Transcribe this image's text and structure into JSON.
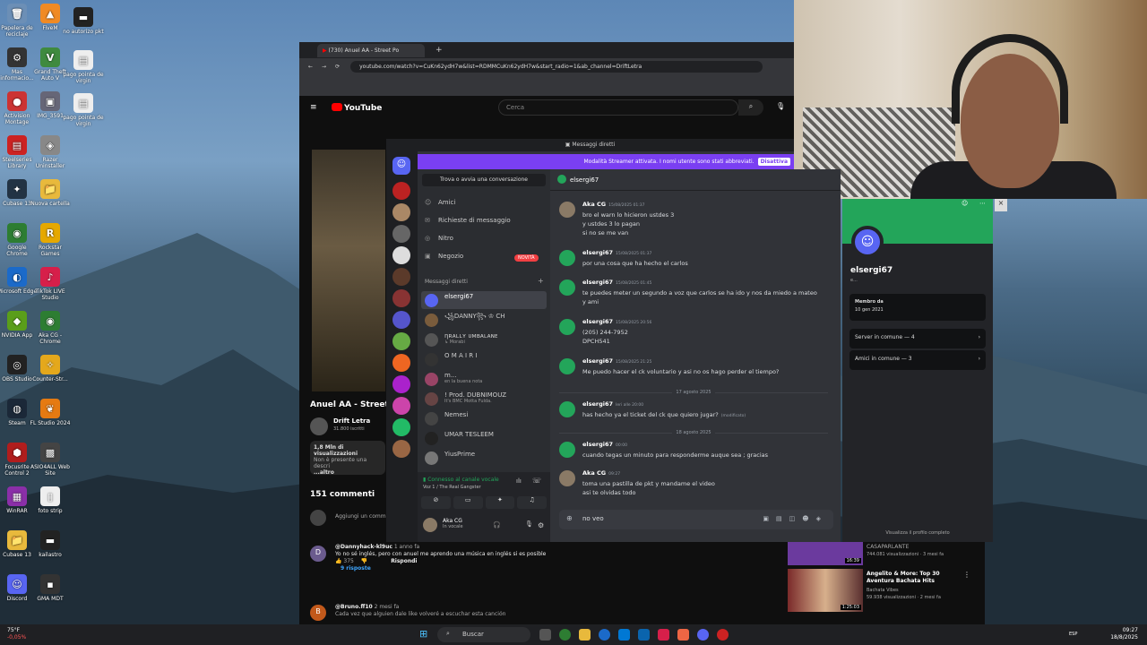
{
  "desktop": {
    "icons": [
      {
        "label": "Papelera de reciclaje",
        "glyph": "🗑",
        "color": "#6c8fb6"
      },
      {
        "label": "Mas informacio...",
        "glyph": "⚙",
        "color": "#333"
      },
      {
        "label": "Activision Montage",
        "glyph": "●",
        "color": "#c33"
      },
      {
        "label": "Steelseries Library",
        "glyph": "▤",
        "color": "#c22"
      },
      {
        "label": "Cubase 13",
        "glyph": "✦",
        "color": "#234"
      },
      {
        "label": "Google Chrome",
        "glyph": "◉",
        "color": "#2d7d32"
      },
      {
        "label": "Microsoft Edge",
        "glyph": "◐",
        "color": "#1b6ac9"
      },
      {
        "label": "NVIDIA App",
        "glyph": "◆",
        "color": "#5a9e1a"
      },
      {
        "label": "OBS Studio",
        "glyph": "◎",
        "color": "#222"
      },
      {
        "label": "Steam",
        "glyph": "◍",
        "color": "#1b2838"
      },
      {
        "label": "Focusrite Control 2",
        "glyph": "⬢",
        "color": "#b01d1d"
      },
      {
        "label": "WinRAR",
        "glyph": "▦",
        "color": "#8b2fa8"
      },
      {
        "label": "Cubase 13",
        "glyph": "📁",
        "color": "#e8b93c"
      },
      {
        "label": "Discord",
        "glyph": "☺",
        "color": "#5865f2"
      }
    ],
    "icons2": [
      {
        "label": "FiveM",
        "glyph": "▲",
        "color": "#f08a24"
      },
      {
        "label": "Grand Theft Auto V",
        "glyph": "V",
        "color": "#3f8a3f"
      },
      {
        "label": "IMG_3591",
        "glyph": "▣",
        "color": "#667"
      },
      {
        "label": "Razer Uninstaller",
        "glyph": "◈",
        "color": "#888"
      },
      {
        "label": "Nuova cartella",
        "glyph": "📁",
        "color": "#e8b93c"
      },
      {
        "label": "Rockstar Games",
        "glyph": "R",
        "color": "#e5a800"
      },
      {
        "label": "TikTok LIVE Studio",
        "glyph": "♪",
        "color": "#d61f4a"
      },
      {
        "label": "Aka CG - Chrome",
        "glyph": "◉",
        "color": "#2d7d32"
      },
      {
        "label": "Counter-Str...",
        "glyph": "✧",
        "color": "#e4a81c"
      },
      {
        "label": "FL Studio 2024",
        "glyph": "❦",
        "color": "#e57a12"
      },
      {
        "label": "ASIO4ALL Web Site",
        "glyph": "▩",
        "color": "#444"
      },
      {
        "label": "foto strip",
        "glyph": "▯",
        "color": "#eee"
      },
      {
        "label": "kailastro",
        "glyph": "▬",
        "color": "#222"
      },
      {
        "label": "GMA MDT",
        "glyph": "▪",
        "color": "#333"
      }
    ],
    "icons3": [
      {
        "label": "no autorizo pkt",
        "glyph": "▬",
        "color": "#222"
      },
      {
        "label": "pago pointa de virgin",
        "glyph": "▤",
        "color": "#eee"
      },
      {
        "label": "pago pointa de virgin",
        "glyph": "▤",
        "color": "#eee"
      }
    ]
  },
  "taskbar": {
    "weather_temp": "75°F",
    "weather_text": "-0,05%",
    "search_placeholder": "Buscar",
    "lang": "ESP",
    "time": "09:27",
    "date": "18/8/2025"
  },
  "browser": {
    "tab_title": "(730) Anuel AA - Street Po",
    "url": "youtube.com/watch?v=CuKn62ydH7w&list=RDMMCuKn62ydH7w&start_radio=1&ab_channel=DriftLetra",
    "youtube": {
      "logo": "YouTube",
      "search_placeholder": "Cerca",
      "video_title": "Anuel AA - Street P",
      "channel": "Drift Letra",
      "subscribers": "31.800 iscritti",
      "views": "1,8 Mln di visualizzazioni",
      "desc_line": "Non è presente una descri",
      "desc_more": "...altro",
      "comments_count": "151 commenti",
      "add_comment": "Aggiungi un comm",
      "comments": [
        {
          "avatar": "D",
          "user": "@Dannyhack-kl9uc",
          "age": "1 anno fa",
          "text": "Yo no sé inglés, pero con anuel me aprendo una música en inglés si es posible",
          "likes": "375",
          "reply": "Rispondi",
          "replies": "9 risposte"
        },
        {
          "avatar": "B",
          "user": "@Bruno.ff10",
          "age": "2 mesi fa",
          "text": "Cada vez que alguien dale like volveré a escuchar esta canción"
        }
      ],
      "sidebar": [
        {
          "title": "CASAPARLANTE",
          "meta": "744.081 visualizzazioni · 3 mesi fa",
          "duration": "16:39"
        },
        {
          "title": "Angelito & More: Top 30 Aventura Bachata Hits",
          "channel": "Bachata Vibes",
          "meta": "59.938 visualizzazioni · 2 mesi fa",
          "duration": "1:25:03"
        }
      ]
    }
  },
  "discord": {
    "window_title": "Messaggi diretti",
    "streamer_banner": "Modalità Streamer attivata. I nomi utente sono stati abbreviati.",
    "streamer_button": "Disattiva",
    "find_conversation": "Trova o avvia una conversazione",
    "nav": [
      {
        "icon": "☺",
        "label": "Amici"
      },
      {
        "icon": "✉",
        "label": "Richieste di messaggio"
      },
      {
        "icon": "◎",
        "label": "Nitro"
      },
      {
        "icon": "▣",
        "label": "Negozio",
        "badge": "NOVITÀ"
      }
    ],
    "dm_header": "Messaggi diretti",
    "dm_list": [
      {
        "name": "elsergi67",
        "sub": "",
        "color": "#5865f2",
        "active": true
      },
      {
        "name": "꧁DANNY꧂ ♔ CH",
        "sub": "",
        "color": "#7a5c3c"
      },
      {
        "name": "ηʀᴀʟʟʏ ᴜᴍʙᴀʟᴀɴᴇ",
        "sub": "↳ Morabi",
        "color": "#555"
      },
      {
        "name": "O M A I R I",
        "sub": "",
        "color": "#333"
      },
      {
        "name": "m...",
        "sub": "en la buena nota",
        "color": "#946"
      },
      {
        "name": "! Prod. DUBNIMOUZ",
        "sub": "It's BMC Motta Fulda.",
        "color": "#644"
      },
      {
        "name": "Nemesi",
        "sub": "",
        "color": "#444"
      },
      {
        "name": "UMAR TESLEEM",
        "sub": "",
        "color": "#222"
      },
      {
        "name": "YiusPrime",
        "sub": "",
        "color": "#777"
      }
    ],
    "voice": {
      "status": "Connesso al canale vocale",
      "channel": "Voz 1 / The Real Gangster"
    },
    "user": {
      "name": "Aka CG",
      "status": "In vocale"
    },
    "chat": {
      "recipient": "elsergi67",
      "messages": [
        {
          "author": "Aka CG",
          "time": "15/08/2025 01:37",
          "lines": [
            "bro el warn lo hicieron ustdes 3",
            "y ustdes 3 lo pagan",
            "si no se me van"
          ],
          "color": "#8a7a66"
        },
        {
          "author": "elsergi67",
          "time": "15/08/2025 01:37",
          "lines": [
            "por una cosa que ha hecho el carlos"
          ],
          "color": "#23a55a"
        },
        {
          "author": "elsergi67",
          "time": "15/08/2025 01:45",
          "lines": [
            "te puedes meter un segundo a voz que carlos se ha ido y nos da miedo a mateo",
            "y ami"
          ],
          "color": "#23a55a"
        },
        {
          "author": "elsergi67",
          "time": "15/08/2025 20:56",
          "lines": [
            "(205) 244-7952",
            "DPCH541"
          ],
          "color": "#23a55a"
        },
        {
          "author": "elsergi67",
          "time": "15/08/2025 21:25",
          "lines": [
            "Me puedo hacer el ck voluntario y asi no os hago perder el tiempo?"
          ],
          "color": "#23a55a"
        },
        {
          "author": "elsergi67",
          "time": "Ieri alle 20:00",
          "lines": [
            "has hecho ya el ticket del ck que quiero jugar?"
          ],
          "edited": "(modificato)",
          "color": "#23a55a"
        },
        {
          "author": "elsergi67",
          "time": "00:00",
          "lines": [
            "cuando tegas un minuto para responderme auque sea ; gracias"
          ],
          "color": "#23a55a"
        },
        {
          "author": "Aka CG",
          "time": "09:27",
          "lines": [
            "toma una pastilla de pkt y mandame el video",
            "asi te olvidas todo"
          ],
          "color": "#8a7a66"
        }
      ],
      "dividers": [
        "17 agosto 2025",
        "18 agosto 2025"
      ],
      "composer_value": "no veo"
    },
    "profile": {
      "name": "elsergi67",
      "sub": "e...",
      "member_since_label": "Membro da",
      "member_since": "10 gen 2021",
      "servers_common": "Server in comune — 4",
      "friends_common": "Amici in comune — 3",
      "footer": "Visualizza il profilo completo"
    }
  }
}
